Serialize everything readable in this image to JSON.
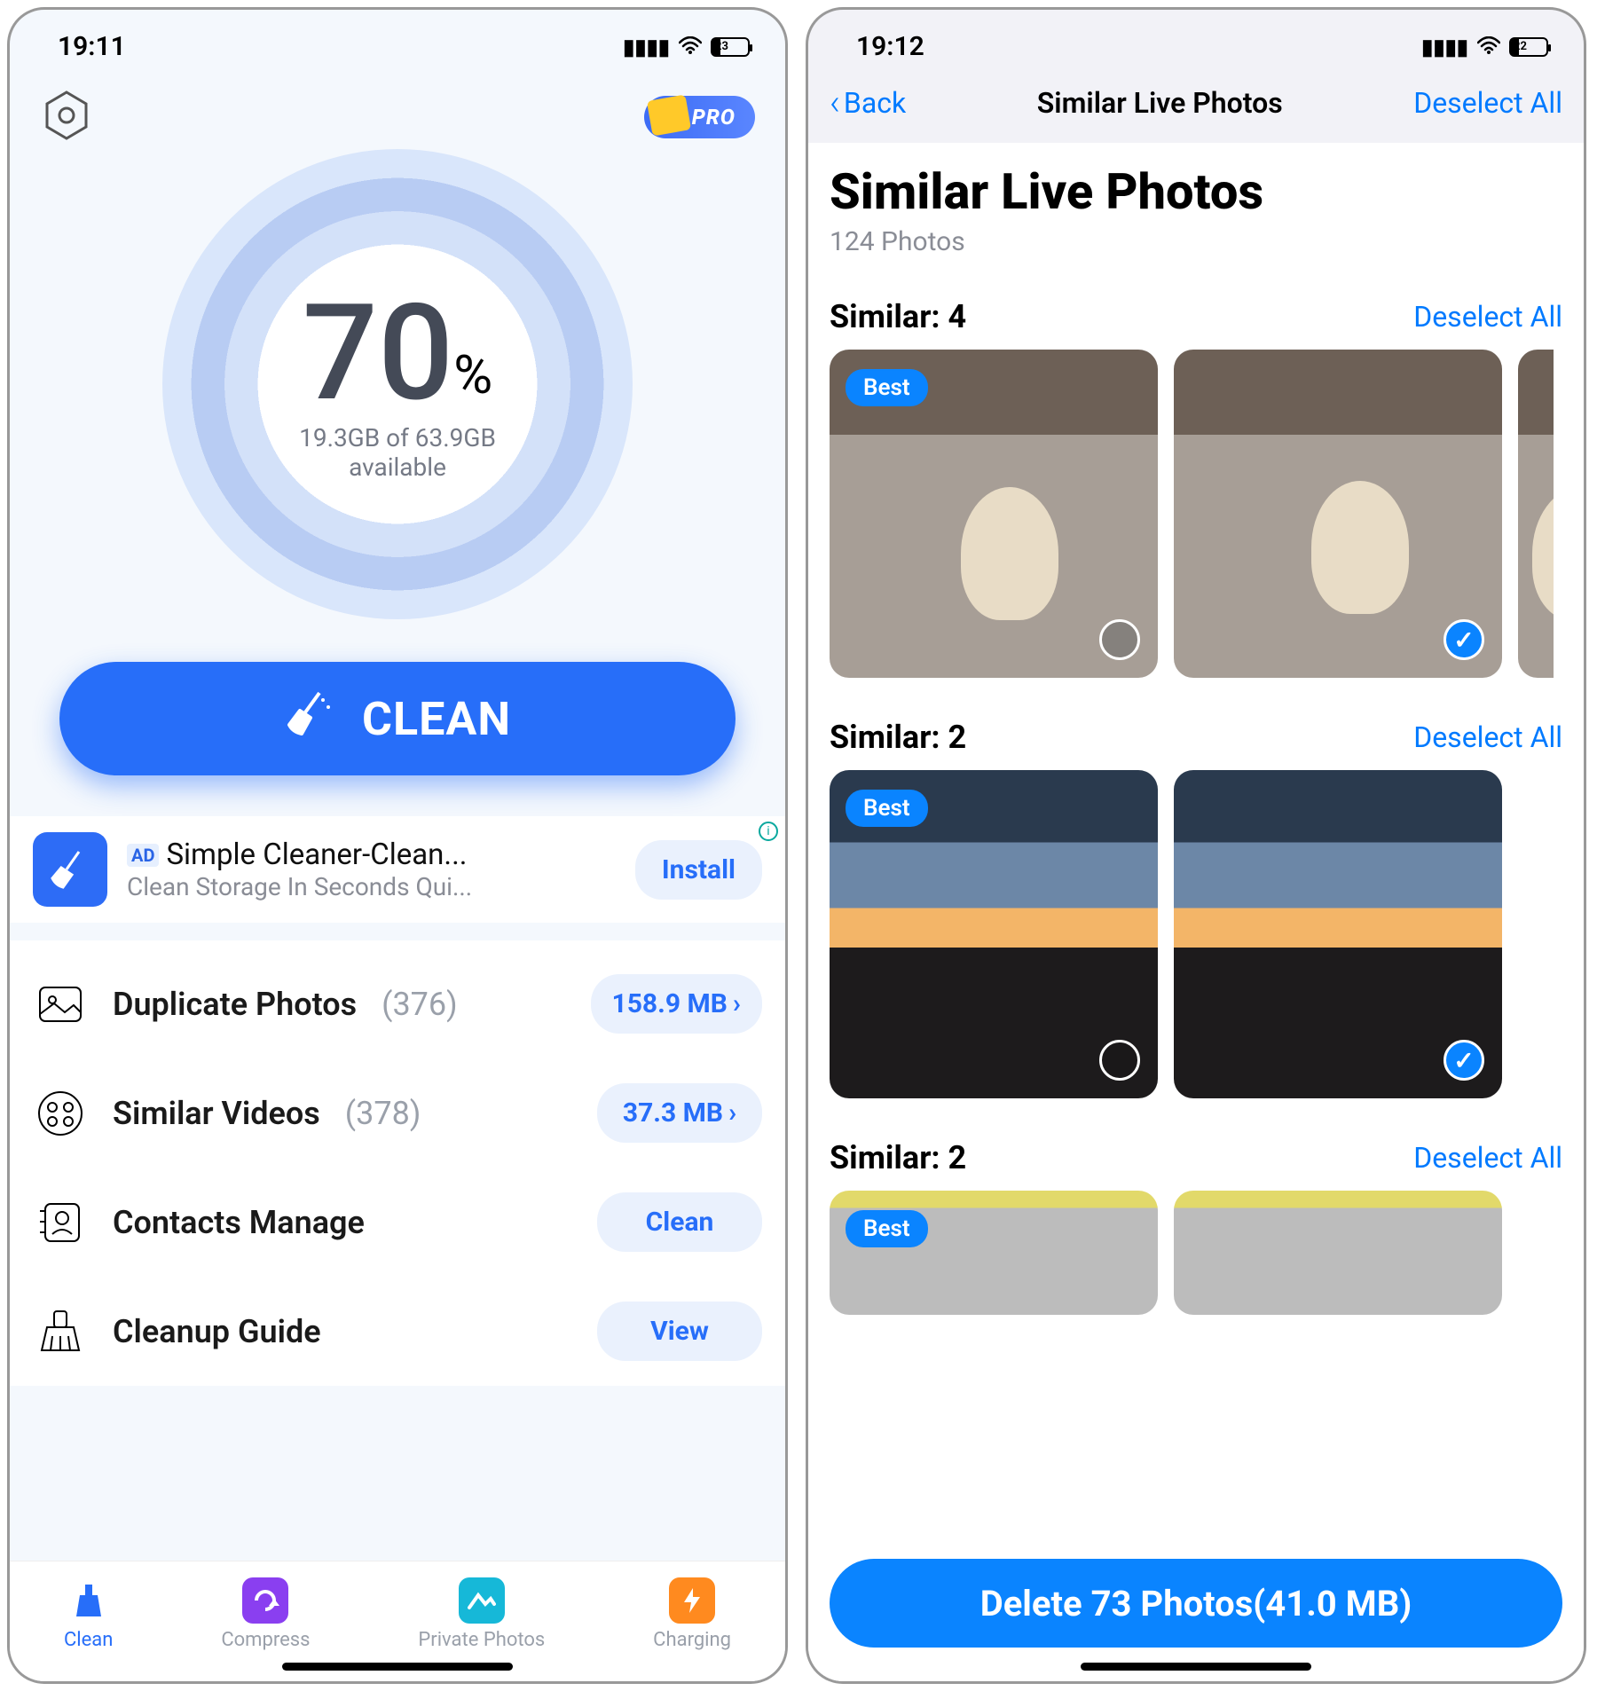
{
  "left": {
    "status": {
      "time": "19:11",
      "battery": "23",
      "battery_pct": 23
    },
    "pro_badge": "PRO",
    "gauge": {
      "pct": "70",
      "pct_sign": "%",
      "storage": "19.3GB of 63.9GB",
      "available": "available"
    },
    "clean_button": "CLEAN",
    "ad": {
      "label": "AD",
      "title": "Simple Cleaner-Clean...",
      "sub": "Clean Storage In Seconds Qui...",
      "install": "Install"
    },
    "rows": {
      "dup_photos": {
        "label": "Duplicate Photos",
        "count": "(376)",
        "size": "158.9 MB"
      },
      "sim_videos": {
        "label": "Similar Videos",
        "count": "(378)",
        "size": "37.3 MB"
      },
      "contacts": {
        "label": "Contacts Manage",
        "action": "Clean"
      },
      "guide": {
        "label": "Cleanup Guide",
        "action": "View"
      }
    },
    "tabs": {
      "clean": "Clean",
      "compress": "Compress",
      "private": "Private Photos",
      "charging": "Charging"
    }
  },
  "right": {
    "status": {
      "time": "19:12",
      "battery": "22",
      "battery_pct": 22
    },
    "nav": {
      "back": "Back",
      "title": "Similar Live Photos",
      "deselect": "Deselect All"
    },
    "header": {
      "title": "Similar Live Photos",
      "count": "124 Photos"
    },
    "best_label": "Best",
    "groups": [
      {
        "title": "Similar: 4",
        "link": "Deselect All"
      },
      {
        "title": "Similar: 2",
        "link": "Deselect All"
      },
      {
        "title": "Similar: 2",
        "link": "Deselect All"
      }
    ],
    "delete_button": "Delete 73 Photos(41.0 MB)"
  }
}
